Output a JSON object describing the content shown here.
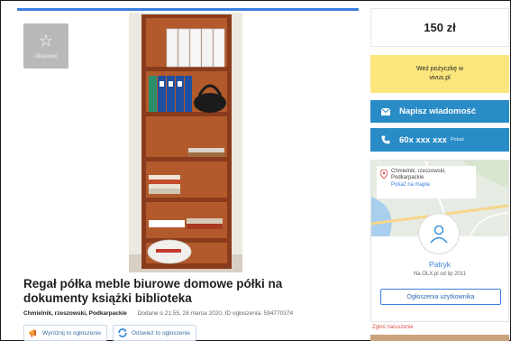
{
  "listing": {
    "observe_label": "Obserwuj",
    "title": "Regał półka meble biurowe domowe półki na dokumenty książki biblioteka",
    "location": "Chmielnik, rzeszowski, Podkarpackie",
    "added": "Dodane o 21:55, 28 marca 2020, ID ogłoszenia: 594770374",
    "promote_label": "Wyróżnij to ogłoszenie",
    "refresh_label": "Odśwież to ogłoszenie"
  },
  "sidebar": {
    "price": "150 zł",
    "loan_text": "Weź pożyczkę w vivus.pl",
    "message_label": "Napisz wiadomość",
    "phone_number": "60x xxx xxx",
    "phone_show": "Pokaż",
    "map_location": "Chmielnik, rzeszowski, Podkarpackie",
    "map_show": "Pokaż na mapie",
    "user_name": "Patryk",
    "user_since": "Na OLX.pl od lip 2011",
    "user_ads_label": "Ogłoszenia użytkownika",
    "report_label": "Zgłoś naruszenie"
  },
  "colors": {
    "accent_blue": "#2a8cc7",
    "link_blue": "#3b7fe0",
    "loan_yellow": "#fbe67e",
    "report_red": "#d9534f"
  }
}
